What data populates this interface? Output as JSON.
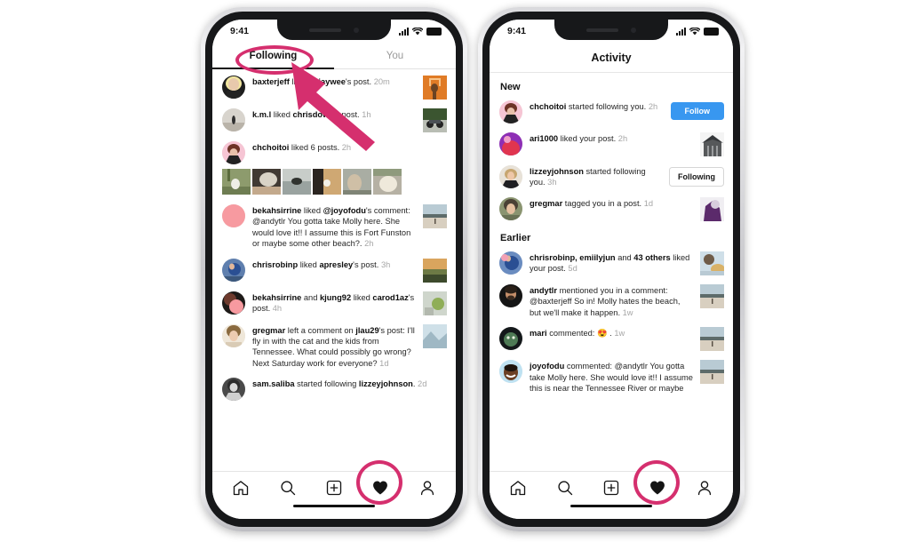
{
  "meta": {
    "app": "Instagram",
    "accent_pink": "#d52f6e",
    "accent_blue": "#3897f0",
    "text_primary": "#262626",
    "text_muted": "#a6a6a6"
  },
  "left_phone": {
    "status_bar": {
      "time": "9:41",
      "signal_icon": "cellular-bars-icon",
      "wifi_icon": "wifi-icon",
      "battery_icon": "battery-icon"
    },
    "tabs": [
      {
        "label": "Following",
        "active": true
      },
      {
        "label": "You",
        "active": false
      }
    ],
    "items": [
      {
        "avatar": "avatar-baxterjeff",
        "user": "baxterjeff",
        "action": " liked ",
        "target": "miaywee",
        "suffix": "'s post.",
        "time": "20m",
        "thumb": "thumb-orange-basketball"
      },
      {
        "avatar": "avatar-kml",
        "user": "k.m.l",
        "action": " liked ",
        "target": "chrisdows",
        "suffix": "'s post.",
        "time": "1h",
        "thumb": "thumb-motorcycle"
      },
      {
        "avatar": "avatar-chchoitoi",
        "user": "chchoitoi",
        "action": " liked 6 posts.",
        "target": "",
        "suffix": "",
        "time": "2h",
        "thumb_grid": [
          "thumb-dog-field",
          "thumb-dog-car",
          "thumb-dog-water",
          "thumb-dog-tan",
          "thumb-dog-grey",
          "thumb-dog-white"
        ]
      },
      {
        "avatar": "avatar-bekahsirrine",
        "user": "bekahsirrine",
        "action": " liked ",
        "target": "@joyofodu",
        "suffix": "'s comment: @andytlr You gotta take Molly here. She would love it!! I assume this is Fort Funston or maybe some other beach?.",
        "time": "2h",
        "thumb": "thumb-beach"
      },
      {
        "avatar": "avatar-chrisrobinp",
        "user": "chrisrobinp",
        "action": " liked ",
        "target": "apresley",
        "suffix": "'s post.",
        "time": "3h",
        "thumb": "thumb-sunset-field"
      },
      {
        "avatar": "avatar-bekahsirrine-2",
        "user": "bekahsirrine",
        "action": " and ",
        "target": "kjung92",
        "suffix": " liked ",
        "target2": "carod1az",
        "suffix2": "'s post.",
        "time": "4h",
        "thumb": "thumb-drink"
      },
      {
        "avatar": "avatar-gregmar",
        "user": "gregmar",
        "action": " left a comment on ",
        "target": "jlau29",
        "suffix": "'s post:  I'll fly in with the cat and the kids from Tennessee. What could possibly go wrong? Next Saturday work for everyone?",
        "time": "1d",
        "thumb": "thumb-ice"
      },
      {
        "avatar": "avatar-samsaliba",
        "user": "sam.saliba",
        "action": " started following ",
        "target": "lizzeyjohnson",
        "suffix": ".",
        "time": "2d",
        "thumb": ""
      }
    ],
    "bottom_nav": [
      {
        "icon": "home-icon",
        "name": "home"
      },
      {
        "icon": "search-icon",
        "name": "search"
      },
      {
        "icon": "add-post-icon",
        "name": "add-post"
      },
      {
        "icon": "heart-icon",
        "name": "activity",
        "active": true
      },
      {
        "icon": "profile-icon",
        "name": "profile"
      }
    ]
  },
  "right_phone": {
    "status_bar": {
      "time": "9:41",
      "signal_icon": "cellular-bars-icon",
      "wifi_icon": "wifi-icon",
      "battery_icon": "battery-icon"
    },
    "header_title": "Activity",
    "sections": [
      {
        "title": "New",
        "items": [
          {
            "avatar": "avatar-chchoitoi",
            "user": "chchoitoi",
            "action": " started following you.",
            "time": "2h",
            "button": "Follow",
            "button_style": "primary"
          },
          {
            "avatar": "avatar-ari1000",
            "user": "ari1000",
            "action": " liked your post.",
            "time": "2h",
            "thumb": "thumb-building"
          },
          {
            "avatar": "avatar-lizzeyjohnson",
            "user": "lizzeyjohnson",
            "action": " started following you.",
            "time": "3h",
            "button": "Following",
            "button_style": "secondary"
          },
          {
            "avatar": "avatar-gregmar",
            "user": "gregmar",
            "action": " tagged you in a post.",
            "time": "1d",
            "thumb": "thumb-purple-dog"
          }
        ]
      },
      {
        "title": "Earlier",
        "items": [
          {
            "avatar": "avatar-chrisrobinp",
            "user": "chrisrobinp, emiilyjun",
            "action": " and ",
            "bold2": "43 others",
            "action2": " liked your post.",
            "time": "5d",
            "thumb": "thumb-beach-hat"
          },
          {
            "avatar": "avatar-andytlr",
            "user": "andytlr",
            "action": " mentioned you in a comment: @baxterjeff So in! Molly hates the beach, but we'll make it happen.",
            "time": "1w",
            "thumb": "thumb-beach"
          },
          {
            "avatar": "avatar-mari",
            "user": "mari",
            "action": " commented: 😍 .",
            "time": "1w",
            "thumb": "thumb-beach"
          },
          {
            "avatar": "avatar-joyofodu",
            "user": "joyofodu",
            "action": " commented: @andytlr You gotta take Molly here. She would love it!! I assume this is near the Tennessee River or maybe",
            "time": "",
            "thumb": "thumb-beach"
          }
        ]
      }
    ],
    "bottom_nav": [
      {
        "icon": "home-icon",
        "name": "home"
      },
      {
        "icon": "search-icon",
        "name": "search"
      },
      {
        "icon": "add-post-icon",
        "name": "add-post"
      },
      {
        "icon": "heart-icon",
        "name": "activity",
        "active": true
      },
      {
        "icon": "profile-icon",
        "name": "profile"
      }
    ]
  },
  "annotations": {
    "ellipse_following": "highlight-ellipse-following-tab",
    "ellipse_heart_left": "highlight-ellipse-activity-tab",
    "ellipse_heart_right": "highlight-ellipse-activity-tab",
    "arrow": "pointer-arrow-to-following-tab",
    "color": "#d52f6e"
  }
}
